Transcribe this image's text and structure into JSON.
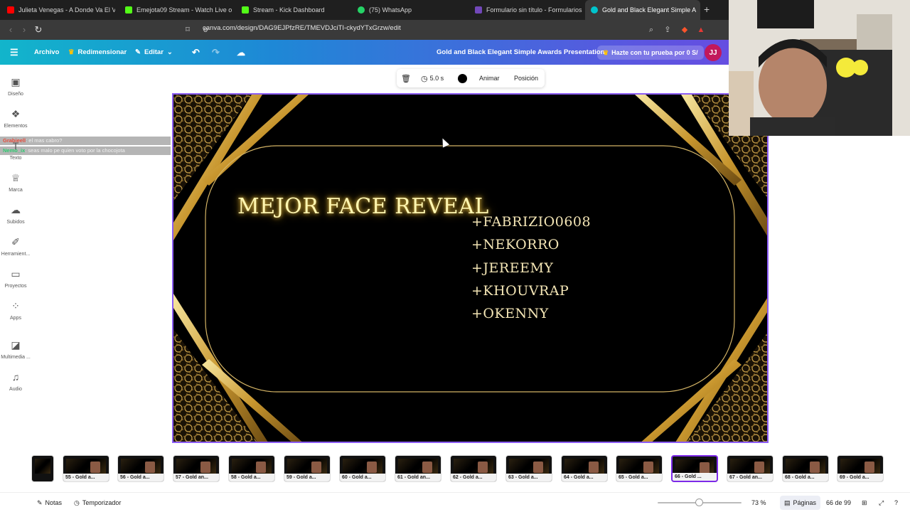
{
  "browser": {
    "tabs": [
      {
        "title": "Julieta Venegas - A Donde Va El Vien",
        "icon_color": "#ff0000"
      },
      {
        "title": "Emejota09 Stream - Watch Live o",
        "icon_color": "#53fc18"
      },
      {
        "title": "Stream - Kick Dashboard",
        "icon_color": "#53fc18"
      },
      {
        "title": "(75) WhatsApp",
        "icon_color": "#25d366"
      },
      {
        "title": "Formulario sin título - Formularios de",
        "icon_color": "#7248b9"
      },
      {
        "title": "Gold and Black Elegant Simple A",
        "icon_color": "#00c4cc",
        "active": true
      }
    ],
    "url": "canva.com/design/DAG9EJPfzRE/TMEVDJciTI-ckydYTxGrzw/edit"
  },
  "header": {
    "menu": "Archivo",
    "resize": "Redimensionar",
    "edit": "Editar",
    "design_title": "Gold and Black Elegant Simple Awards Presentation",
    "trial": "Hazte con tu prueba por 0 S/",
    "avatar": "JJ"
  },
  "sidebar": {
    "items": [
      {
        "label": "Diseño",
        "icon": "layout-icon"
      },
      {
        "label": "Elementos",
        "icon": "shapes-icon"
      },
      {
        "label": "Texto",
        "icon": "text-icon"
      },
      {
        "label": "Marca",
        "icon": "brand-icon"
      },
      {
        "label": "Subidos",
        "icon": "upload-icon"
      },
      {
        "label": "Herramient...",
        "icon": "tools-icon"
      },
      {
        "label": "Proyectos",
        "icon": "folder-icon"
      },
      {
        "label": "Apps",
        "icon": "apps-icon"
      },
      {
        "label": "Multimedia ...",
        "icon": "media-icon"
      },
      {
        "label": "Audio",
        "icon": "audio-icon"
      }
    ]
  },
  "chat": [
    {
      "user": "Grabieell",
      "message": ": el mas cabro?"
    },
    {
      "user": "Nemo_ix",
      "message": ": seas malo pe quien voto por la chocojota"
    }
  ],
  "context_toolbar": {
    "duration": "5.0 s",
    "animate": "Animar",
    "position": "Posición"
  },
  "slide": {
    "title": "MEJOR FACE REVEAL",
    "nominees": [
      "+FABRIZIO0608",
      "+NEKORRO",
      "+JEREEMY",
      "+KHOUVRAP",
      "+OKENNY"
    ],
    "accent_color": "#d4a84b"
  },
  "filmstrip": [
    {
      "label": "",
      "partial": true
    },
    {
      "label": "55 - Gold a..."
    },
    {
      "label": "56 - Gold a..."
    },
    {
      "label": "57 - Gold an..."
    },
    {
      "label": "58 - Gold a..."
    },
    {
      "label": "59 - Gold a..."
    },
    {
      "label": "60 - Gold a..."
    },
    {
      "label": "61 - Gold an..."
    },
    {
      "label": "62 - Gold a..."
    },
    {
      "label": "63 - Gold a..."
    },
    {
      "label": "64 - Gold a..."
    },
    {
      "label": "65 - Gold a..."
    },
    {
      "label": "66 - Gold ...",
      "active": true
    },
    {
      "label": "67 - Gold an..."
    },
    {
      "label": "68 - Gold a..."
    },
    {
      "label": "69 - Gold a..."
    }
  ],
  "footer": {
    "notes": "Notas",
    "timer": "Temporizador",
    "zoom": "73 %",
    "zoom_fraction": 0.45,
    "pages_button": "Páginas",
    "page_count": "66 de 99"
  }
}
